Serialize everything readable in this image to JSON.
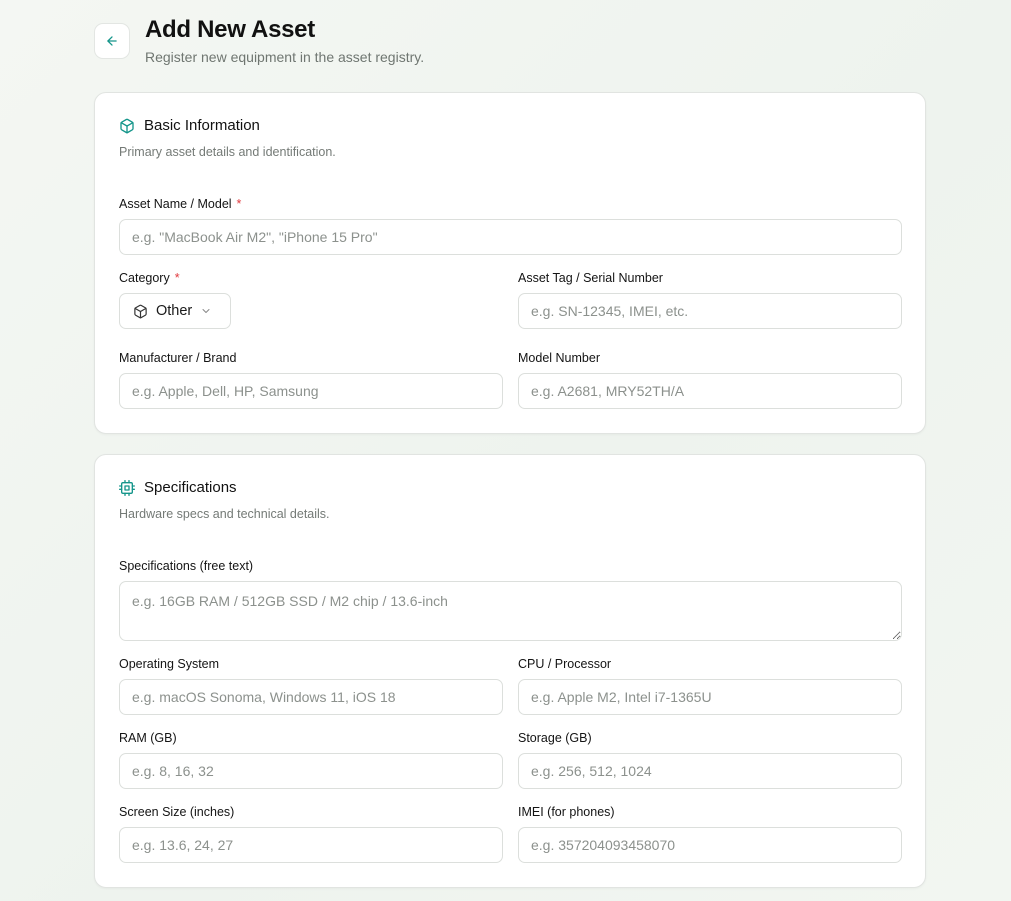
{
  "colors": {
    "accent": "#14958a",
    "required": "#e0393e"
  },
  "header": {
    "back_icon": "arrow-left-icon",
    "title": "Add New Asset",
    "subtitle": "Register new equipment in the asset registry."
  },
  "basic_info": {
    "icon": "box-icon",
    "title": "Basic Information",
    "description": "Primary asset details and identification.",
    "asset_name": {
      "label": "Asset Name / Model",
      "required_mark": "*",
      "placeholder": "e.g. \"MacBook Air M2\", \"iPhone 15 Pro\""
    },
    "category": {
      "label": "Category",
      "required_mark": "*",
      "value": "Other",
      "icon": "box-icon"
    },
    "asset_tag": {
      "label": "Asset Tag / Serial Number",
      "placeholder": "e.g. SN-12345, IMEI, etc."
    },
    "manufacturer": {
      "label": "Manufacturer / Brand",
      "placeholder": "e.g. Apple, Dell, HP, Samsung"
    },
    "model_number": {
      "label": "Model Number",
      "placeholder": "e.g. A2681, MRY52TH/A"
    }
  },
  "specifications": {
    "icon": "cpu-icon",
    "title": "Specifications",
    "description": "Hardware specs and technical details.",
    "specs_text": {
      "label": "Specifications (free text)",
      "placeholder": "e.g. 16GB RAM / 512GB SSD / M2 chip / 13.6-inch"
    },
    "os": {
      "label": "Operating System",
      "placeholder": "e.g. macOS Sonoma, Windows 11, iOS 18"
    },
    "cpu": {
      "label": "CPU / Processor",
      "placeholder": "e.g. Apple M2, Intel i7-1365U"
    },
    "ram": {
      "label": "RAM (GB)",
      "placeholder": "e.g. 8, 16, 32"
    },
    "storage": {
      "label": "Storage (GB)",
      "placeholder": "e.g. 256, 512, 1024"
    },
    "screen_size": {
      "label": "Screen Size (inches)",
      "placeholder": "e.g. 13.6, 24, 27"
    },
    "imei": {
      "label": "IMEI (for phones)",
      "placeholder": "e.g. 357204093458070"
    }
  }
}
